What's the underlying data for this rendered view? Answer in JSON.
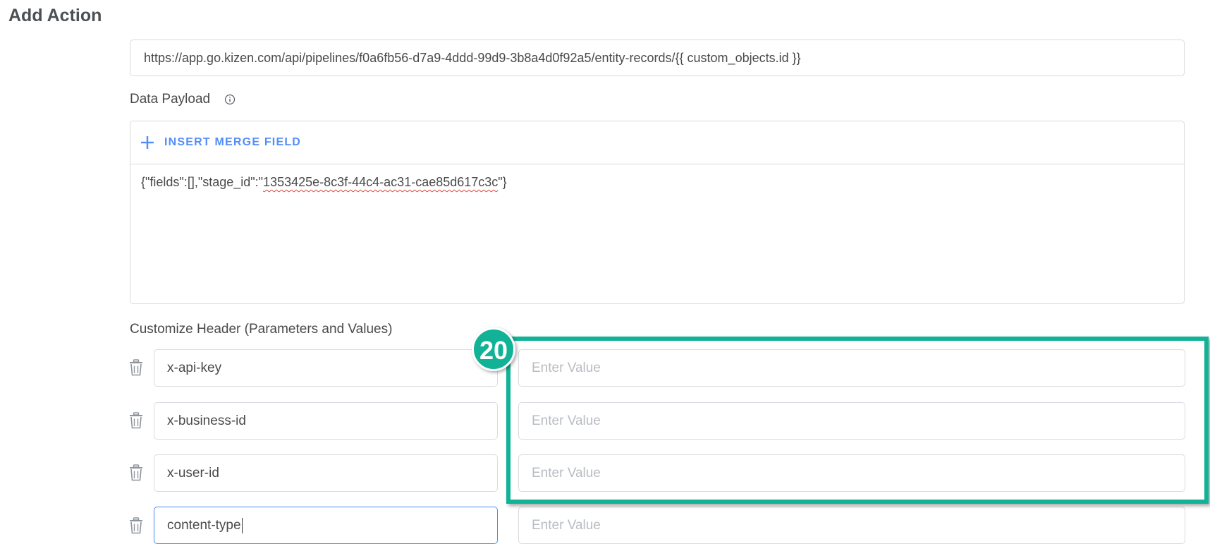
{
  "page": {
    "title": "Add Action"
  },
  "webhook": {
    "url": "https://app.go.kizen.com/api/pipelines/f0a6fb56-d7a9-4ddd-99d9-3b8a4d0f92a5/entity-records/{{ custom_objects.id }}"
  },
  "payload": {
    "label": "Data Payload",
    "insert_merge_field_label": "INSERT MERGE FIELD",
    "text_prefix": "{\"fields\":[],\"stage_id\":\"",
    "text_misspelled": "1353425e-8c3f-44c4-ac31-cae85d617c3c",
    "text_suffix": "\"}"
  },
  "headers": {
    "label": "Customize Header (Parameters and Values)",
    "rows": [
      {
        "key": "x-api-key",
        "value_placeholder": "Enter Value"
      },
      {
        "key": "x-business-id",
        "value_placeholder": "Enter Value"
      },
      {
        "key": "x-user-id",
        "value_placeholder": "Enter Value"
      },
      {
        "key": "content-type",
        "value_placeholder": "Enter Value"
      }
    ]
  },
  "annotation": {
    "step_number": "20",
    "color": "#12b297"
  },
  "colors": {
    "accent": "#528ef9",
    "focus_border": "#4a8cf2",
    "border": "#d8dbe0",
    "placeholder": "#b8bcc2"
  }
}
